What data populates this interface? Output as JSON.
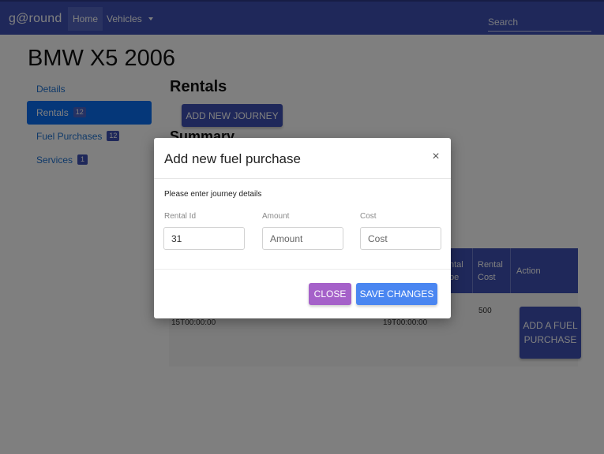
{
  "navbar": {
    "brand": "g@round",
    "home_label": "Home",
    "vehicles_label": "Vehicles",
    "search_placeholder": "Search"
  },
  "page": {
    "title": "BMW X5 2006"
  },
  "sidebar": {
    "items": [
      {
        "label": "Details",
        "badge": null
      },
      {
        "label": "Rentals",
        "badge": "12"
      },
      {
        "label": "Fuel Purchases",
        "badge": "12"
      },
      {
        "label": "Services",
        "badge": "1"
      }
    ]
  },
  "main": {
    "section_title": "Rentals",
    "add_journey_label": "ADD NEW JOURNEY",
    "summary_title": "Summary",
    "table": {
      "headers": [
        "ntal",
        "pe",
        "Rental",
        "Cost",
        "Action"
      ],
      "row": {
        "start_fragment": "15T00:00:00",
        "end_fragment": "19T00:00:00",
        "rental_cost": "500",
        "action_label": "ADD A FUEL PURCHASE"
      }
    }
  },
  "modal": {
    "title": "Add new fuel purchase",
    "close_icon": "×",
    "subtitle": "Please enter journey details",
    "fields": {
      "rental_id": {
        "label": "Rental Id",
        "value": "31",
        "placeholder": ""
      },
      "amount": {
        "label": "Amount",
        "value": "",
        "placeholder": "Amount"
      },
      "cost": {
        "label": "Cost",
        "value": "",
        "placeholder": "Cost"
      }
    },
    "close_button": "CLOSE",
    "save_button": "SAVE CHANGES"
  },
  "colors": {
    "primary": "#3f51b5",
    "active_nav": "#0b6ef2",
    "close_button": "#a561c9",
    "save_button": "#4a86f1"
  }
}
